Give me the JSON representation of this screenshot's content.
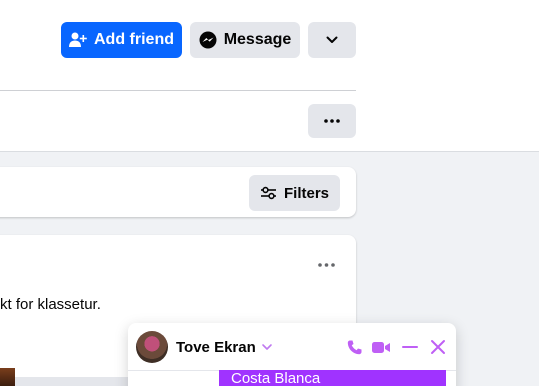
{
  "profile_actions": {
    "add_friend_label": "Add friend",
    "message_label": "Message"
  },
  "posts": {
    "filters_label": "Filters",
    "post_text": "kt for klassetur."
  },
  "chat": {
    "contact_name": "Tove Ekran",
    "last_message": "Costa Blanca",
    "accent_color": "#a033ff"
  },
  "colors": {
    "primary": "#0866ff",
    "secondary_button": "#e4e6eb",
    "page_background": "#f0f2f5"
  }
}
